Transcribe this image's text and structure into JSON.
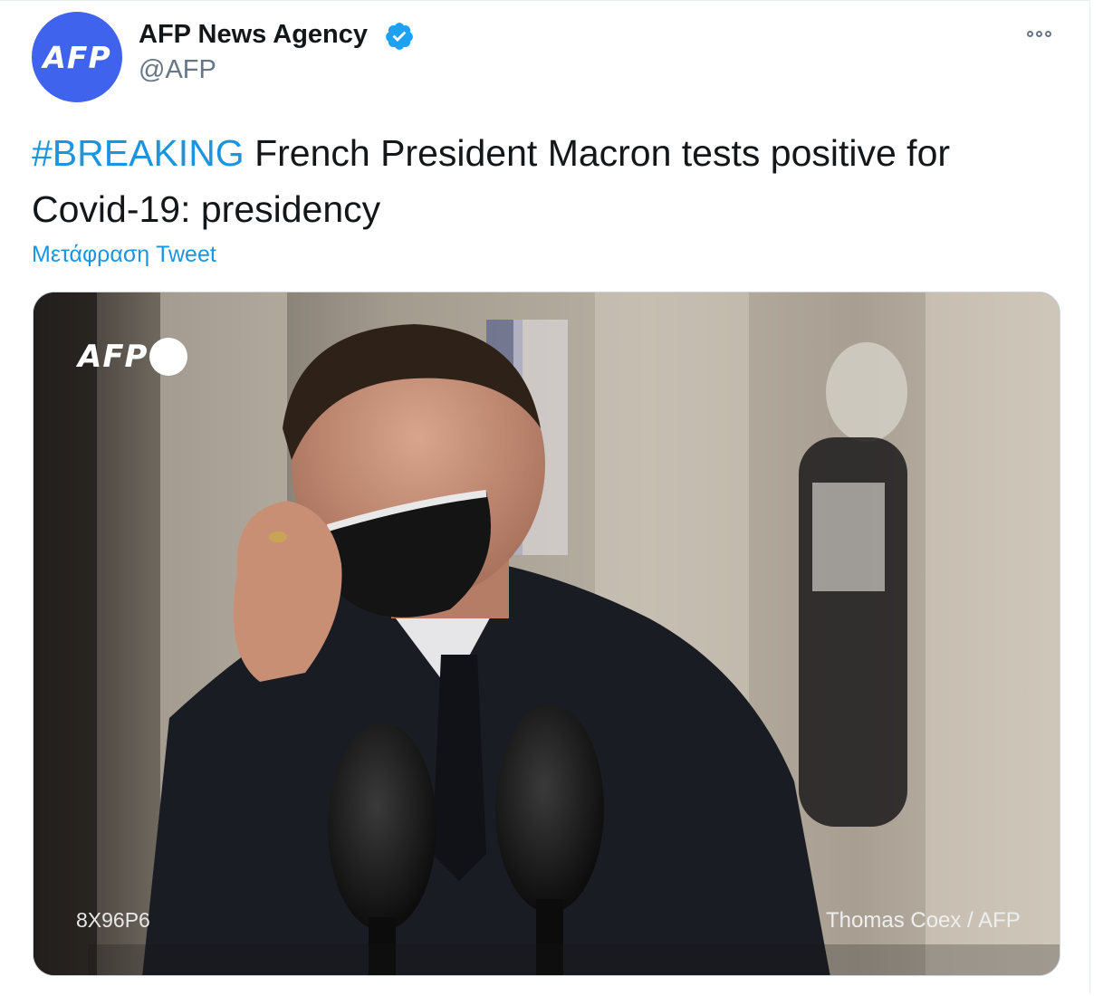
{
  "author": {
    "avatar_text": "AFP",
    "display_name": "AFP News Agency",
    "handle": "@AFP",
    "verified_icon": "verified-badge-icon"
  },
  "tweet": {
    "hashtag": "#BREAKING",
    "text": " French President Macron tests positive for Covid-19: presidency",
    "translate_label": "Μετάφραση Tweet"
  },
  "media": {
    "logo_text": "AFP",
    "photo_id": "8X96P6",
    "credit": "Thomas Coex / AFP"
  },
  "colors": {
    "link": "#1b95e0",
    "avatar_bg": "#3f63ec",
    "text": "#14171a",
    "secondary": "#657786"
  }
}
